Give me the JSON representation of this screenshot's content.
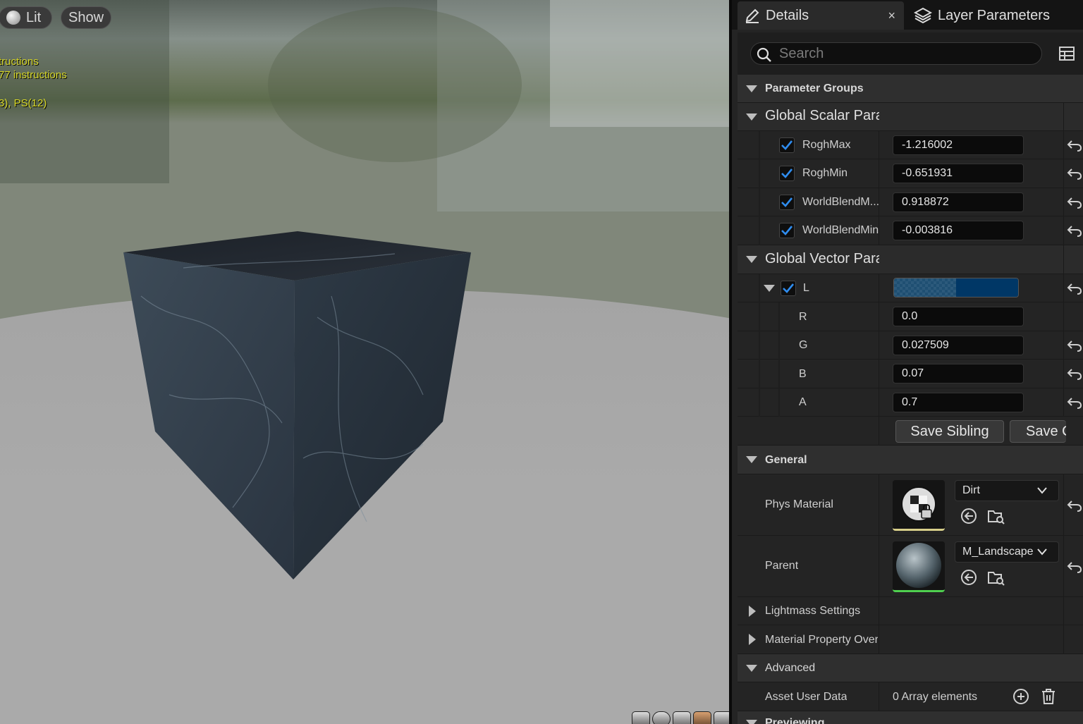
{
  "viewport": {
    "lit_label": "Lit",
    "show_label": "Show",
    "stats": [
      "tructions",
      "77 instructions",
      "3), PS(12)"
    ],
    "preview_shapes": [
      "cylinder-icon",
      "sphere-icon",
      "plane-icon",
      "cube-icon",
      "custom-mesh-icon"
    ]
  },
  "tabs": {
    "details": "Details",
    "close": "×",
    "layer_parameters": "Layer Parameters"
  },
  "search": {
    "placeholder": "Search"
  },
  "sections": {
    "parameter_groups": "Parameter Groups",
    "global_scalar": "Global Scalar Parameter Values",
    "global_vector": "Global Vector Parameter Values",
    "general": "General",
    "lightmass": "Lightmass Settings",
    "material_property": "Material Property Overrides",
    "advanced": "Advanced",
    "previewing": "Previewing"
  },
  "scalar_params": [
    {
      "name": "RoghMax",
      "value": "-1.216002",
      "checked": true
    },
    {
      "name": "RoghMin",
      "value": "-0.651931",
      "checked": true
    },
    {
      "name": "WorldBlendM...",
      "value": "0.918872",
      "checked": true
    },
    {
      "name": "WorldBlendMin",
      "value": "-0.003816",
      "checked": true
    }
  ],
  "vector_param": {
    "name": "L",
    "color_hex": "#003766",
    "channels": [
      {
        "name": "R",
        "value": "0.0"
      },
      {
        "name": "G",
        "value": "0.027509"
      },
      {
        "name": "B",
        "value": "0.07"
      },
      {
        "name": "A",
        "value": "0.7"
      }
    ]
  },
  "buttons": {
    "save_sibling": "Save Sibling",
    "save_child": "Save Child"
  },
  "general": {
    "phys_material": {
      "label": "Phys Material",
      "value": "Dirt"
    },
    "parent": {
      "label": "Parent",
      "value": "M_Landscape"
    }
  },
  "advanced": {
    "asset_user_data_label": "Asset User Data",
    "asset_user_data_value": "0 Array elements"
  },
  "colors": {
    "panel_bg": "#242424",
    "accent_check": "#2f8df0",
    "viewport_floor": "#a9a9a9"
  }
}
